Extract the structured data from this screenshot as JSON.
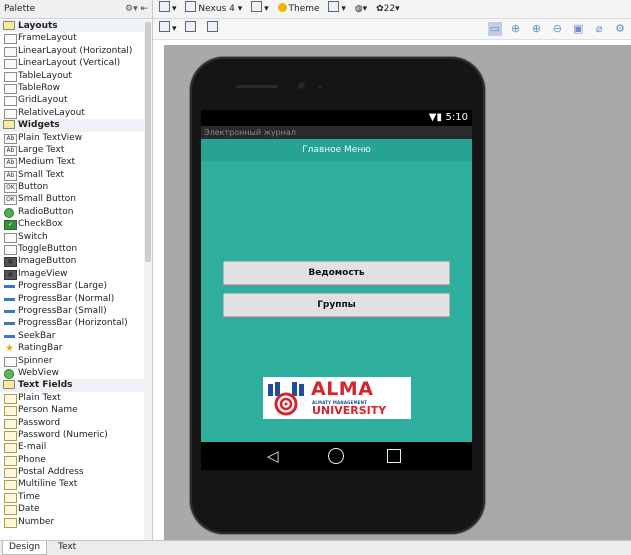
{
  "palette": {
    "title": "Palette",
    "sections": [
      {
        "label": "Layouts",
        "items": [
          {
            "label": "FrameLayout",
            "icon": "layout-icon"
          },
          {
            "label": "LinearLayout (Horizontal)",
            "icon": "layout-icon"
          },
          {
            "label": "LinearLayout (Vertical)",
            "icon": "layout-icon"
          },
          {
            "label": "TableLayout",
            "icon": "table-icon"
          },
          {
            "label": "TableRow",
            "icon": "table-icon"
          },
          {
            "label": "GridLayout",
            "icon": "grid-icon"
          },
          {
            "label": "RelativeLayout",
            "icon": "layout-icon"
          }
        ]
      },
      {
        "label": "Widgets",
        "items": [
          {
            "label": "Plain TextView",
            "icon": "textview-icon"
          },
          {
            "label": "Large Text",
            "icon": "textview-icon"
          },
          {
            "label": "Medium Text",
            "icon": "textview-icon"
          },
          {
            "label": "Small Text",
            "icon": "textview-icon"
          },
          {
            "label": "Button",
            "icon": "button-icon"
          },
          {
            "label": "Small Button",
            "icon": "button-icon"
          },
          {
            "label": "RadioButton",
            "icon": "radio-icon"
          },
          {
            "label": "CheckBox",
            "icon": "checkbox-icon"
          },
          {
            "label": "Switch",
            "icon": "switch-icon"
          },
          {
            "label": "ToggleButton",
            "icon": "toggle-icon"
          },
          {
            "label": "ImageButton",
            "icon": "image-icon"
          },
          {
            "label": "ImageView",
            "icon": "image-icon"
          },
          {
            "label": "ProgressBar (Large)",
            "icon": "progress-icon"
          },
          {
            "label": "ProgressBar (Normal)",
            "icon": "progress-icon"
          },
          {
            "label": "ProgressBar (Small)",
            "icon": "progress-icon"
          },
          {
            "label": "ProgressBar (Horizontal)",
            "icon": "progress-icon"
          },
          {
            "label": "SeekBar",
            "icon": "seekbar-icon"
          },
          {
            "label": "RatingBar",
            "icon": "star-icon"
          },
          {
            "label": "Spinner",
            "icon": "spinner-icon"
          },
          {
            "label": "WebView",
            "icon": "globe-icon"
          }
        ]
      },
      {
        "label": "Text Fields",
        "items": [
          {
            "label": "Plain Text",
            "icon": "textfield-icon"
          },
          {
            "label": "Person Name",
            "icon": "textfield-icon"
          },
          {
            "label": "Password",
            "icon": "textfield-icon"
          },
          {
            "label": "Password (Numeric)",
            "icon": "textfield-icon"
          },
          {
            "label": "E-mail",
            "icon": "textfield-icon"
          },
          {
            "label": "Phone",
            "icon": "textfield-icon"
          },
          {
            "label": "Postal Address",
            "icon": "textfield-icon"
          },
          {
            "label": "Multiline Text",
            "icon": "textfield-icon"
          },
          {
            "label": "Time",
            "icon": "textfield-icon"
          },
          {
            "label": "Date",
            "icon": "textfield-icon"
          },
          {
            "label": "Number",
            "icon": "textfield-icon"
          }
        ]
      }
    ]
  },
  "toolbar": {
    "device": "Nexus 4",
    "theme": "Theme",
    "api": "22"
  },
  "device_screen": {
    "time": "5:10",
    "app_title": "Электронный журнал",
    "header": "Главное Меню",
    "buttons": [
      "Ведомость",
      "Группы"
    ],
    "logo": {
      "name": "ALMA",
      "line1": "ALMATY MANAGEMENT",
      "line2": "UNIVERSITY"
    }
  },
  "tabs": {
    "design": "Design",
    "text": "Text"
  },
  "colors": {
    "screen_bg": "#2eaf9e",
    "header_bg": "#26a392",
    "logo_red": "#d8232a",
    "logo_blue": "#1d4f9c"
  }
}
